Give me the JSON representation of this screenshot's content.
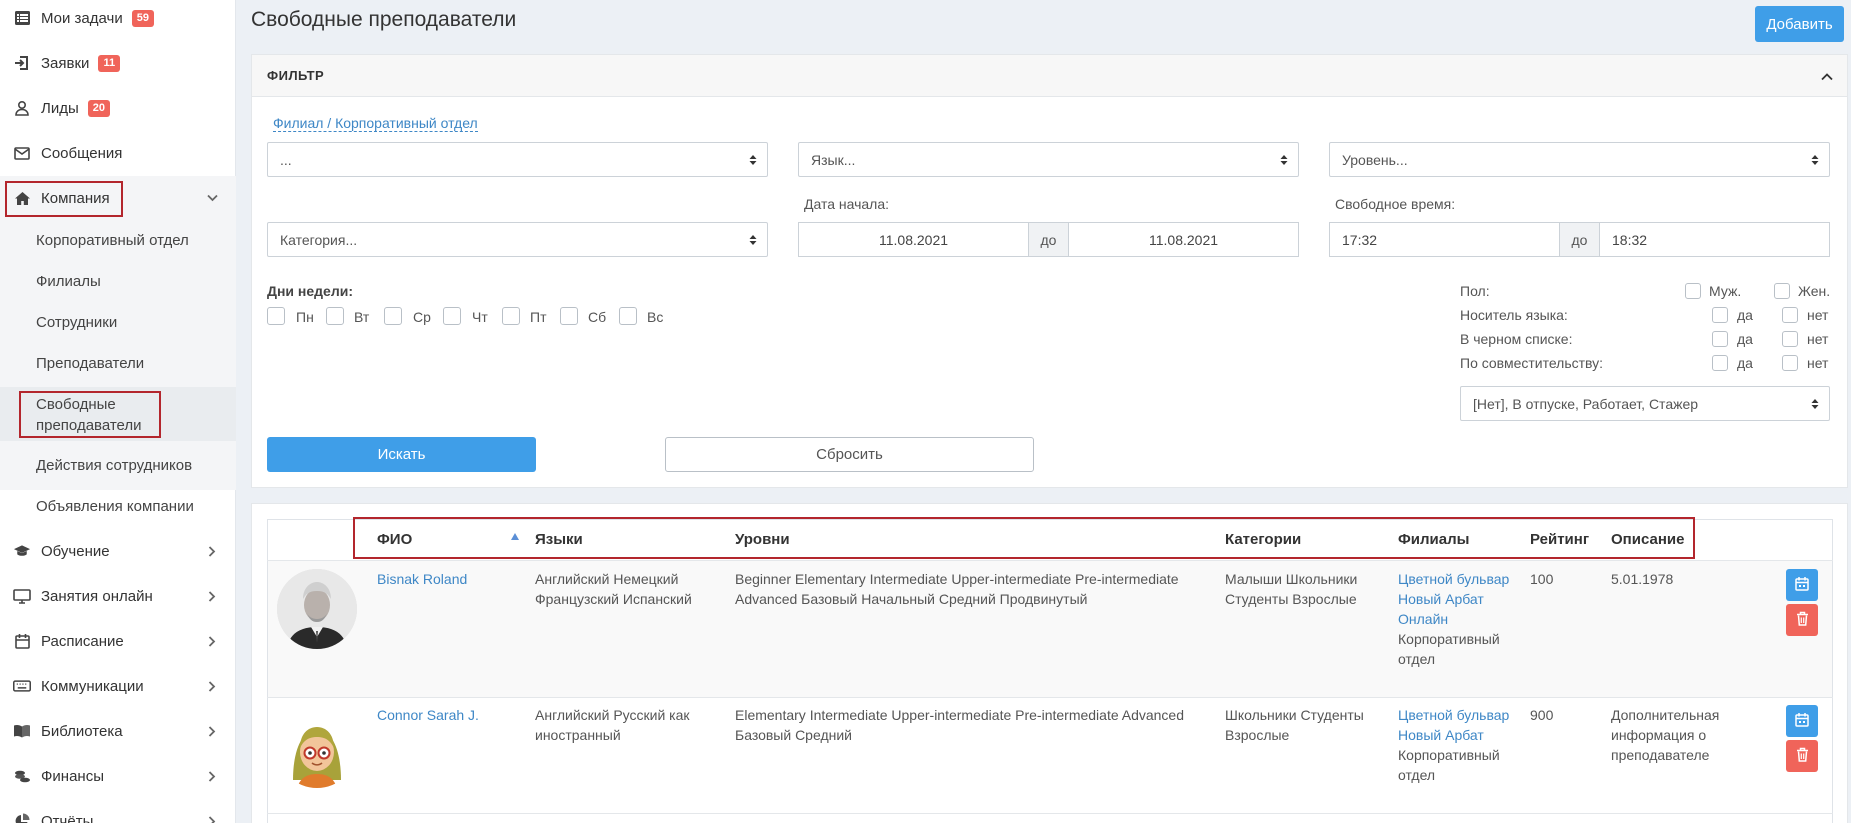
{
  "sidebar": {
    "items": [
      {
        "label": "Мои задачи",
        "badge": "59",
        "icon": "list-icon"
      },
      {
        "label": "Заявки",
        "badge": "11",
        "icon": "sign-in-icon"
      },
      {
        "label": "Лиды",
        "badge": "20",
        "icon": "user-icon"
      },
      {
        "label": "Сообщения",
        "icon": "envelope-icon"
      },
      {
        "label": "Компания",
        "icon": "home-icon"
      },
      {
        "label": "Обучение",
        "icon": "graduation-cap-icon"
      },
      {
        "label": "Занятия онлайн",
        "icon": "monitor-icon"
      },
      {
        "label": "Расписание",
        "icon": "calendar-icon"
      },
      {
        "label": "Коммуникации",
        "icon": "keyboard-icon"
      },
      {
        "label": "Библиотека",
        "icon": "book-icon"
      },
      {
        "label": "Финансы",
        "icon": "coins-icon"
      },
      {
        "label": "Отчёты",
        "icon": "pie-chart-icon"
      }
    ],
    "company_sub": [
      "Корпоративный отдел",
      "Филиалы",
      "Сотрудники",
      "Преподаватели",
      "Свободные преподаватели",
      "Действия сотрудников",
      "Объявления компании"
    ]
  },
  "header": {
    "title": "Свободные преподаватели",
    "add_label": "Добавить"
  },
  "filter": {
    "title": "ФИЛЬТР",
    "branch_link": "Филиал / Корпоративный отдел",
    "branch_value": "...",
    "language": "Язык...",
    "level": "Уровень...",
    "category": "Категория...",
    "start_date_label": "Дата начала:",
    "date_from": "11.08.2021",
    "date_sep": "до",
    "date_to": "11.08.2021",
    "free_time_label": "Свободное время:",
    "time_from": "17:32",
    "time_sep": "до",
    "time_to": "18:32",
    "weekdays_label": "Дни недели:",
    "weekdays": [
      "Пн",
      "Вт",
      "Ср",
      "Чт",
      "Пт",
      "Сб",
      "Вс"
    ],
    "gender_label": "Пол:",
    "male": "Муж.",
    "female": "Жен.",
    "native_label": "Носитель языка:",
    "blacklist_label": "В черном списке:",
    "parttime_label": "По совместительству:",
    "yes": "да",
    "no": "нет",
    "status": "[Нет], В отпуске, Работает, Стажер",
    "search_label": "Искать",
    "reset_label": "Сбросить"
  },
  "table": {
    "columns": [
      "ФИО",
      "Языки",
      "Уровни",
      "Категории",
      "Филиалы",
      "Рейтинг",
      "Описание"
    ],
    "rows": [
      {
        "name": "Bisnak Roland",
        "languages": "Английский Немецкий Французский Испанский",
        "levels": "Beginner Elementary Intermediate Upper-intermediate Pre-intermediate Advanced Базовый Начальный Средний Продвинутый",
        "categories": "Малыши Школьники Студенты Взрослые",
        "branch_links": [
          "Цветной бульвар",
          "Новый Арбат",
          "Онлайн"
        ],
        "branch_text": "Корпоративный отдел",
        "rating": "100",
        "description": "5.01.1978"
      },
      {
        "name": "Connor Sarah J.",
        "languages": "Английский Русский как иностранный",
        "levels": "Elementary Intermediate Upper-intermediate Pre-intermediate Advanced Базовый Средний",
        "categories": "Школьники Студенты Взрослые",
        "branch_links": [
          "Цветной бульвар",
          "Новый Арбат"
        ],
        "branch_text": "Корпоративный отдел",
        "rating": "900",
        "description": "Дополнительная информация о преподавателе"
      }
    ]
  }
}
